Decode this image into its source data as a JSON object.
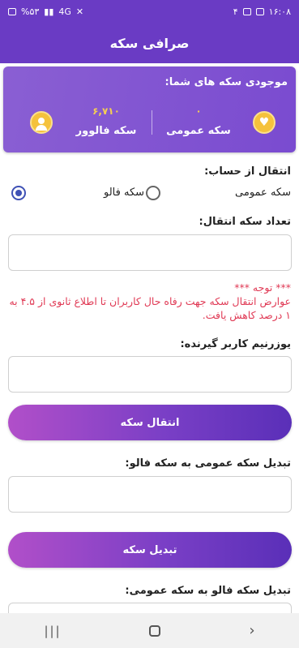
{
  "status_bar": {
    "time": "۱۶:۰۸",
    "notifications": "۴",
    "battery": "%۵۳",
    "network": "4G"
  },
  "app_bar": {
    "title": "صرافی سکه"
  },
  "balance": {
    "title": "موجودی سکه های شما:",
    "general_value": "۰",
    "general_label": "سکه عمومی",
    "follow_value": "۶,۷۱۰",
    "follow_label": "سکه فالوور"
  },
  "transfer": {
    "from_label": "انتقال از حساب:",
    "option_general": "سکه عمومی",
    "option_follow": "سکه فالو",
    "amount_label": "تعداد سکه انتقال:",
    "notice_title": "*** توجه ***",
    "notice_text": "عوارض انتقال سکه جهت رفاه حال کاربران تا اطلاع ثانوی از ۴.۵ به ۱ درصد کاهش یافت.",
    "username_label": "یوزرنیم کاربر گیرنده:",
    "button": "انتقال سکه"
  },
  "convert_general": {
    "label": "تبدیل سکه عمومی به سکه فالو:",
    "button": "تبدیل سکه"
  },
  "convert_follow": {
    "label": "تبدیل سکه فالو به سکه عمومی:"
  },
  "colors": {
    "primary": "#6a3bc4",
    "accent_gold": "#f5c23c",
    "notice_red": "#e03a55"
  }
}
